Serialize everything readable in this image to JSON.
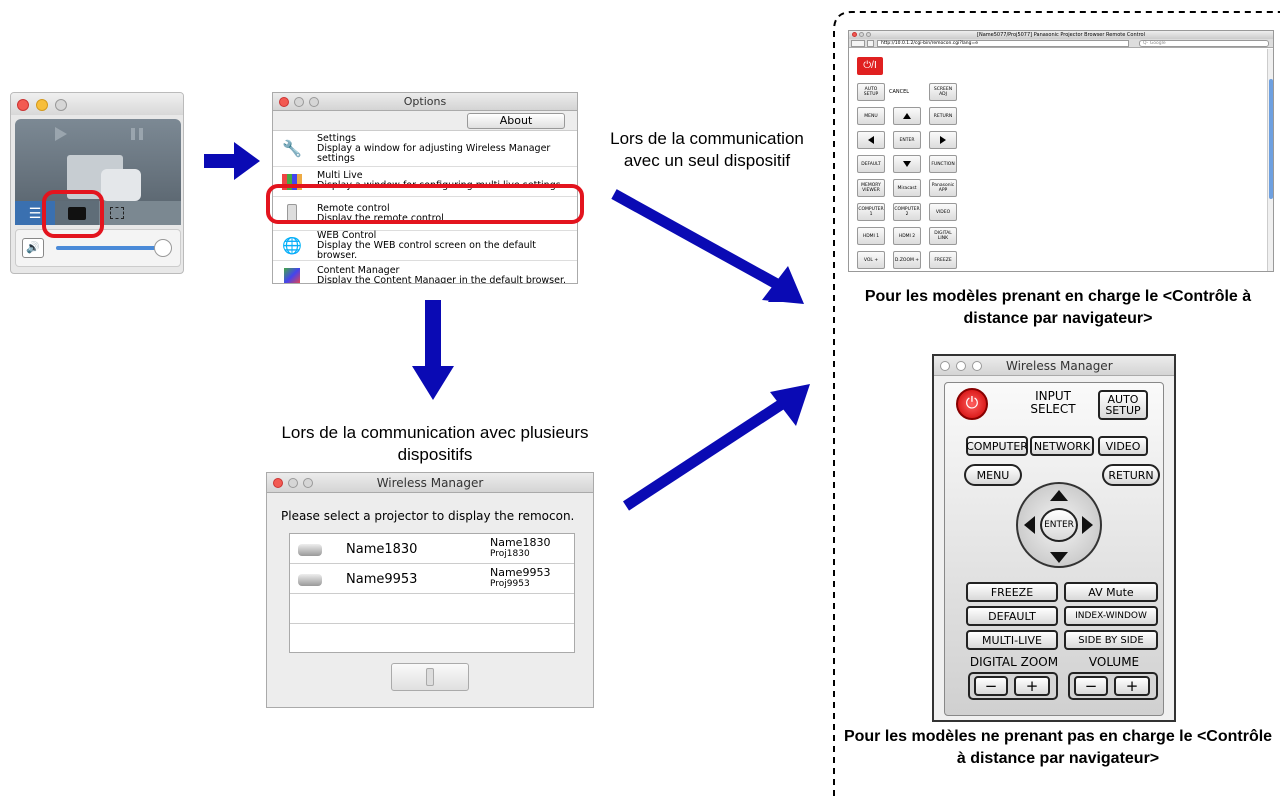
{
  "labels": {
    "single_device": "Lors de la communication avec un seul dispositif",
    "multiple_devices": "Lors de la communication avec plusieurs dispositifs",
    "browser_supported": "Pour les modèles prenant en charge le <Contrôle à distance par navigateur>",
    "browser_not_supported": "Pour les modèles ne prenant pas en charge le <Contrôle à distance par navigateur>"
  },
  "options_window": {
    "title": "Options",
    "about_label": "About",
    "items": [
      {
        "icon": "wrench-icon",
        "title": "Settings",
        "desc": "Display a window for adjusting Wireless Manager settings"
      },
      {
        "icon": "multi-live-icon",
        "title": "Multi Live",
        "desc": "Display a window for configuring multi live settings"
      },
      {
        "icon": "remote-icon",
        "title": "Remote control",
        "desc": "Display the remote control"
      },
      {
        "icon": "globe-icon",
        "title": "WEB Control",
        "desc": "Display the WEB control screen on the default browser."
      },
      {
        "icon": "content-manager-icon",
        "title": "Content Manager",
        "desc": "Display the Content Manager in the default browser."
      }
    ]
  },
  "select_window": {
    "title": "Wireless Manager",
    "prompt": "Please select a projector to display the remocon.",
    "projectors": [
      {
        "name": "Name1830",
        "detail_name": "Name1830",
        "detail_proj": "Proj1830"
      },
      {
        "name": "Name9953",
        "detail_name": "Name9953",
        "detail_proj": "Proj9953"
      }
    ]
  },
  "browser_window": {
    "title": "[Name5077/Proj5077] Panasonic Projector Browser Remote Control",
    "url": "http://10.0.1.2/cgi-bin/remocon.cgi?lang=e",
    "search_placeholder": "Q- Google",
    "power_label": "⏻/I",
    "buttons": {
      "auto_setup": "AUTO SETUP",
      "cancel": "CANCEL",
      "screen_adj": "SCREEN ADJ",
      "menu": "MENU",
      "return": "RETURN",
      "enter": "ENTER",
      "default": "DEFAULT",
      "function": "FUNCTION",
      "memory_viewer": "MEMORY VIEWER",
      "miracast": "Miracast",
      "panasonic_app": "Panasonic APP",
      "computer1": "COMPUTER 1",
      "computer2": "COMPUTER 2",
      "video": "VIDEO",
      "hdmi1": "HDMI 1",
      "hdmi2": "HDMI 2",
      "digital_link": "DIGITAL LINK",
      "vol_plus": "VOL +",
      "dzoom_plus": "D.ZOOM +",
      "freeze": "FREEZE"
    }
  },
  "remote_window": {
    "title": "Wireless Manager",
    "input_select": "INPUT SELECT",
    "auto_setup": "AUTO SETUP",
    "computer": "COMPUTER",
    "network": "NETWORK",
    "video": "VIDEO",
    "menu": "MENU",
    "return": "RETURN",
    "enter": "ENTER",
    "freeze": "FREEZE",
    "av_mute": "AV Mute",
    "default": "DEFAULT",
    "index_window": "INDEX-WINDOW",
    "multi_live": "MULTI-LIVE",
    "side_by_side": "SIDE BY SIDE",
    "digital_zoom": "DIGITAL ZOOM",
    "volume": "VOLUME",
    "minus": "−",
    "plus": "+"
  },
  "colors": {
    "arrow_blue": "#0a0ab4",
    "highlight_red": "#e3141e",
    "power_red": "#e02020"
  }
}
